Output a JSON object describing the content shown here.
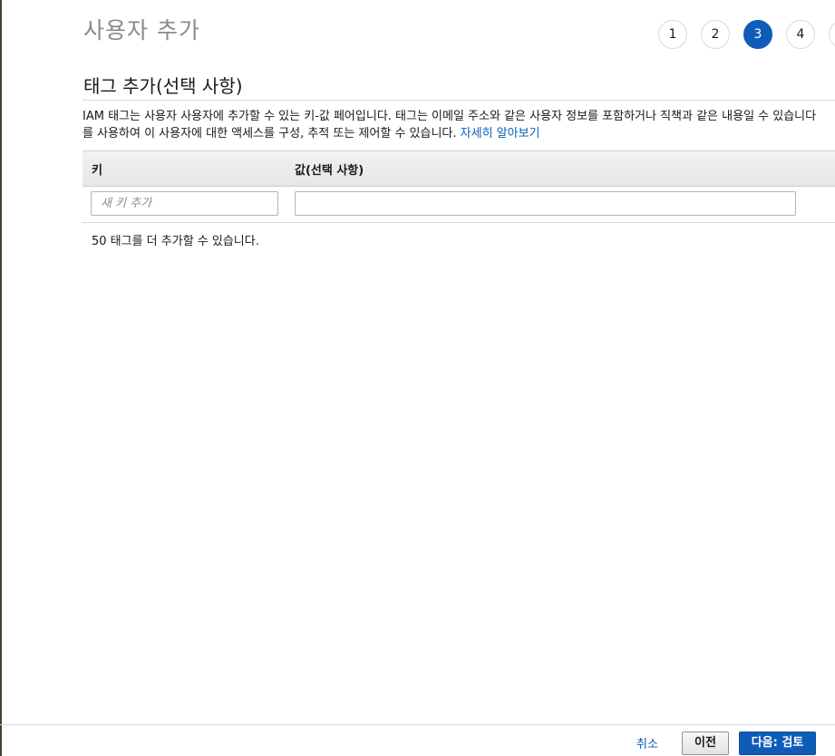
{
  "page": {
    "title": "사용자 추가"
  },
  "stepper": {
    "steps": [
      "1",
      "2",
      "3",
      "4",
      ""
    ],
    "active_step": "3"
  },
  "tags_section": {
    "title": "태그 추가(선택 사항)",
    "description_line1": "IAM 태그는 사용자 사용자에 추가할 수 있는 키-값 페어입니다. 태그는 이메일 주소와 같은 사용자 정보를 포함하거나 직책과 같은 내용일 수 있습니다",
    "description_line2": "를 사용하여 이 사용자에 대한 액세스를 구성, 추적 또는 제어할 수 있습니다. ",
    "learn_more_link": "자세히 알아보기"
  },
  "table": {
    "columns": {
      "key": "키",
      "value": "값(선택 사항)"
    },
    "row": {
      "key_placeholder": "새 키 추가",
      "key_value": "",
      "value_value": ""
    }
  },
  "remaining_text": "50 태그를 더 추가할 수 있습니다.",
  "footer": {
    "cancel_label": "취소",
    "previous_label": "이전",
    "next_label": "다음: 검토"
  }
}
